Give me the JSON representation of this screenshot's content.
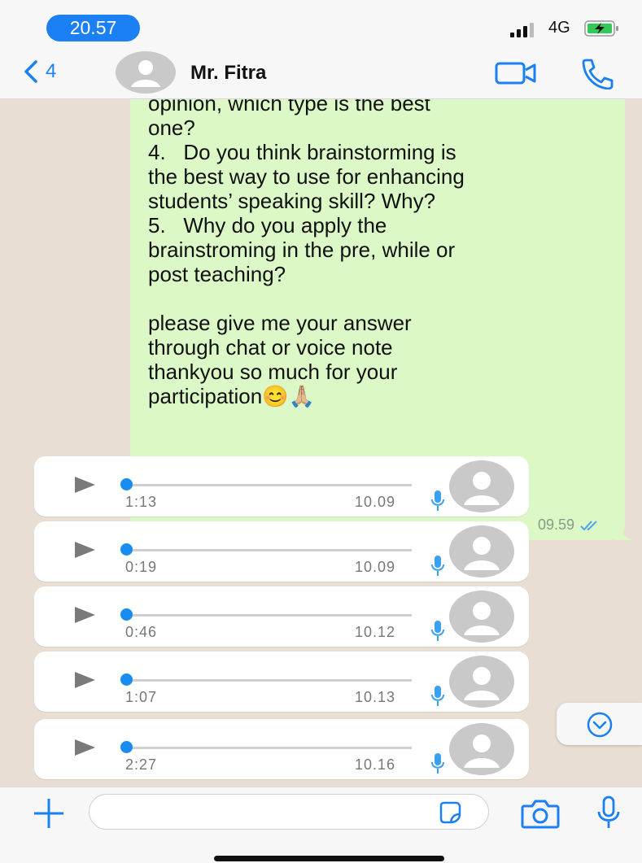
{
  "status_bar": {
    "time": "20.57",
    "network": "4G",
    "icons": [
      "signal-bars-icon",
      "battery-charging-icon"
    ]
  },
  "header": {
    "back_count": "4",
    "contact_name": "Mr. Fitra",
    "icons": [
      "chevron-left-icon",
      "avatar-placeholder-icon",
      "video-camera-icon",
      "phone-icon"
    ]
  },
  "outgoing_message": {
    "text": "teaching and learning activity\nduring observation? From your\nopinion, which type is the best\none?\n4.   Do you think brainstorming is\nthe best way to use for enhancing\nstudents’ speaking skill? Why?\n5.   Why do you apply the\nbrainstroming in the pre, while or\npost teaching?\n\nplease give me your answer\nthrough chat or voice note\nthankyou so much for your\nparticipation😊🙏🏼",
    "time": "09.59",
    "status": "read-double-check"
  },
  "voice_notes": [
    {
      "duration": "1:13",
      "time": "10.09",
      "progress": 0
    },
    {
      "duration": "0:19",
      "time": "10.09",
      "progress": 0
    },
    {
      "duration": "0:46",
      "time": "10.12",
      "progress": 0
    },
    {
      "duration": "1:07",
      "time": "10.13",
      "progress": 0
    },
    {
      "duration": "2:27",
      "time": "10.16",
      "progress": 0
    }
  ],
  "input_bar": {
    "placeholder": "",
    "icons": [
      "plus-icon",
      "sticker-icon",
      "camera-icon",
      "microphone-icon"
    ]
  },
  "colors": {
    "accent": "#1a80f3",
    "outgoing_bubble": "#dcf8c6",
    "chat_background": "#e9ded3",
    "read_ticks": "#4fa3e8"
  }
}
